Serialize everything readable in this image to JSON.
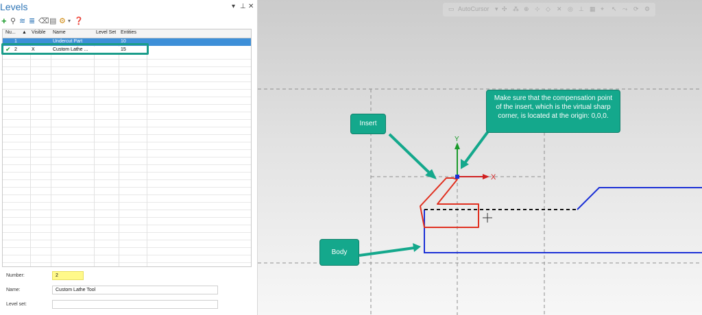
{
  "panel": {
    "title": "Levels",
    "controls": [
      "▾",
      "📌",
      "✕"
    ],
    "toolbar_icons": [
      "add-icon",
      "search-icon",
      "layers-icon",
      "layers-stack-icon",
      "eraser-icon",
      "calculator-icon",
      "gear-icon",
      "help-icon"
    ],
    "table": {
      "headers": [
        "Nu...",
        "▲",
        "Visible",
        "Name",
        "Level Set",
        "Entities"
      ],
      "rows": [
        {
          "check": "",
          "number": "1",
          "visible": "",
          "name": "Undercut Part",
          "level_set": "",
          "entities": "10"
        },
        {
          "check": "✔",
          "number": "2",
          "visible": "X",
          "name": "Custom Lathe ...",
          "level_set": "",
          "entities": "15"
        }
      ]
    },
    "properties": {
      "number_label": "Number:",
      "number_value": "2",
      "name_label": "Name:",
      "name_value": "Custom Lathe Tool",
      "levelset_label": "Level set:",
      "levelset_value": ""
    }
  },
  "viewport": {
    "toolbar": {
      "autocursor_label": "AutoCursor"
    },
    "axes": {
      "y_label": "Y",
      "x_label": "X"
    },
    "callouts": {
      "insert": "Insert",
      "body": "Body",
      "note": "Make sure that the compensation point of the insert, which is the virtual sharp corner, is located at the origin: 0,0,0."
    },
    "colors": {
      "callout": "#14a88c",
      "insert_outline": "#e03020",
      "body_outline": "#1a2fd6",
      "axis_x": "#d02020",
      "axis_y": "#1a9a2a"
    }
  }
}
